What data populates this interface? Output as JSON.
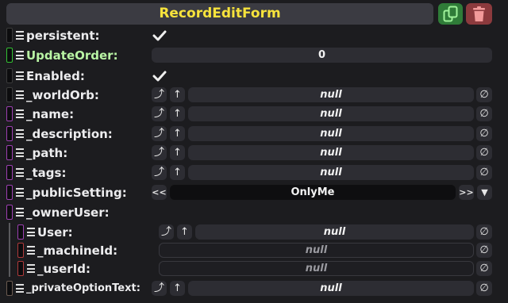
{
  "header": {
    "title": "RecordEditForm",
    "duplicate_icon": "duplicate-icon",
    "delete_icon": "trash-icon"
  },
  "colors": {
    "title": "#f7e33c",
    "duplicate": "#2f7c38",
    "delete": "#8c3a3d",
    "bool_type": "#1a1a1a",
    "int_type": "#33c233",
    "string_type": "#9b3fb0",
    "ref_type": "#b03a3a"
  },
  "fields": {
    "persistent": {
      "label": "persistent:",
      "checked": true
    },
    "update_order": {
      "label": "UpdateOrder:",
      "value": "0"
    },
    "enabled": {
      "label": "Enabled:",
      "checked": true
    },
    "world_orb": {
      "label": "_worldOrb:",
      "value": "null"
    },
    "name": {
      "label": "_name:",
      "value": "null"
    },
    "description": {
      "label": "_description:",
      "value": "null"
    },
    "path": {
      "label": "_path:",
      "value": "null"
    },
    "tags": {
      "label": "_tags:",
      "value": "null"
    },
    "public_setting": {
      "label": "_publicSetting:",
      "value": "OnlyMe",
      "prev": "<<",
      "next": ">>",
      "dropdown": "▼"
    },
    "owner_user": {
      "label": "_ownerUser:",
      "user": {
        "label": "User:",
        "value": "null"
      },
      "machine_id": {
        "label": "_machineId:",
        "value": "null"
      },
      "user_id": {
        "label": "_userId:",
        "value": "null"
      }
    },
    "private_option_text": {
      "label": "_privateOptionText:",
      "value": "null"
    }
  },
  "controls": {
    "jump_glyph": "⤴",
    "up_glyph": "↑",
    "null_glyph": "∅"
  }
}
